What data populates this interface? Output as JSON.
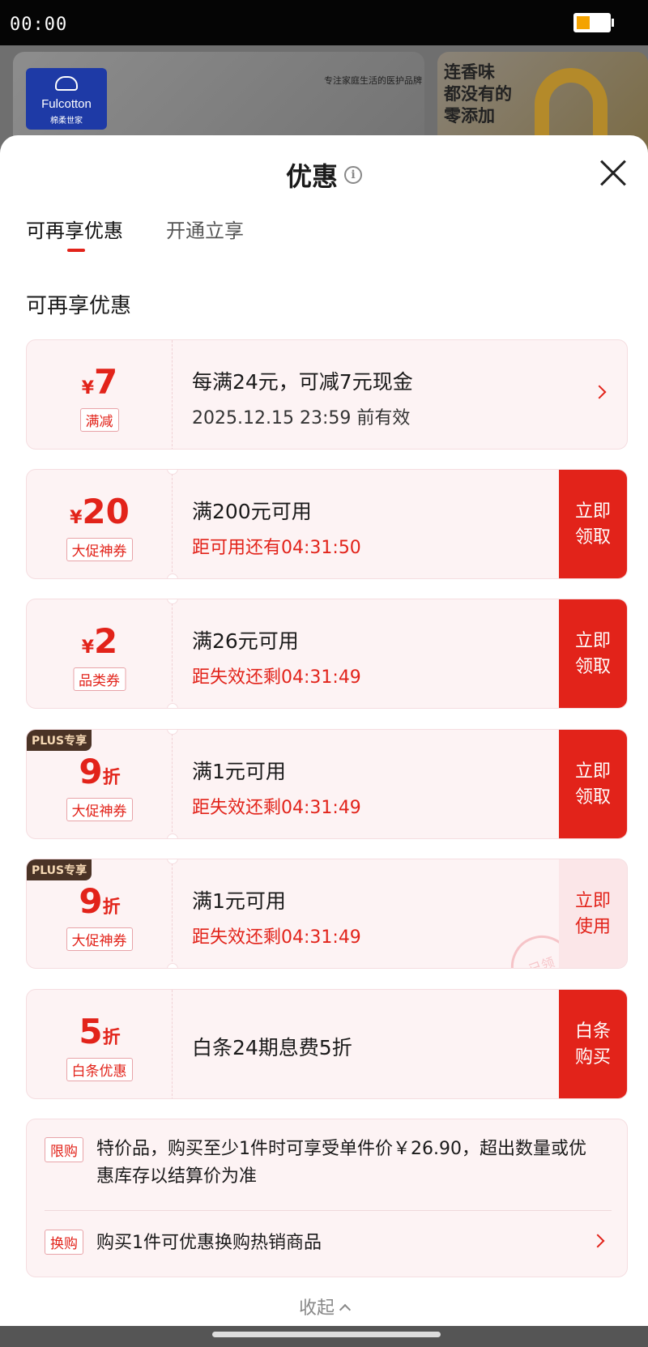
{
  "status_bar": {
    "time": "00:00"
  },
  "background": {
    "logo_text": "Fulcotton",
    "logo_sub": "棉柔世家",
    "tagline": "专注家庭生活的医护品牌",
    "right_banner_text": [
      "连香味",
      "都没有的",
      "零添加"
    ]
  },
  "sheet": {
    "title": "优惠",
    "tabs": [
      {
        "label": "可再享优惠"
      },
      {
        "label": "开通立享"
      }
    ],
    "section_title": "可再享优惠",
    "coupons": [
      {
        "currency": "¥",
        "value": "7",
        "unit": "",
        "tag": "满减",
        "main": "每满24元，可减7元现金",
        "sub": "2025.12.15 23:59 前有效",
        "action": ""
      },
      {
        "currency": "¥",
        "value": "20",
        "unit": "",
        "tag": "大促神券",
        "main": "满200元可用",
        "sub": "距可用还有04:31:50",
        "action": "立即领取"
      },
      {
        "currency": "¥",
        "value": "2",
        "unit": "",
        "tag": "品类券",
        "main": "满26元可用",
        "sub": "距失效还剩04:31:49",
        "action": "立即领取"
      },
      {
        "badge": "PLUS专享",
        "currency": "",
        "value": "9",
        "unit": "折",
        "tag": "大促神券",
        "main": "满1元可用",
        "sub": "距失效还剩04:31:49",
        "action": "立即领取"
      },
      {
        "badge": "PLUS专享",
        "currency": "",
        "value": "9",
        "unit": "折",
        "tag": "大促神券",
        "main": "满1元可用",
        "sub": "距失效还剩04:31:49",
        "action": "立即使用",
        "stamp": "已领"
      },
      {
        "currency": "",
        "value": "5",
        "unit": "折",
        "tag": "白条优惠",
        "main": "白条24期息费5折",
        "sub": "",
        "action": "白条购买"
      }
    ],
    "notes": [
      {
        "tag": "限购",
        "text": "特价品，购买至少1件时可享受单件价￥26.90，超出数量或优惠库存以结算价为准"
      },
      {
        "tag": "换购",
        "text": "购买1件可优惠换购热销商品"
      }
    ],
    "collapse_label": "收起"
  },
  "colors": {
    "accent": "#e2231a",
    "card_bg": "#fdf3f4",
    "plus_badge": "#4a3326"
  },
  "icons": {
    "close": "close-icon",
    "info": "info-icon",
    "chevron": "chevron-right-icon"
  }
}
